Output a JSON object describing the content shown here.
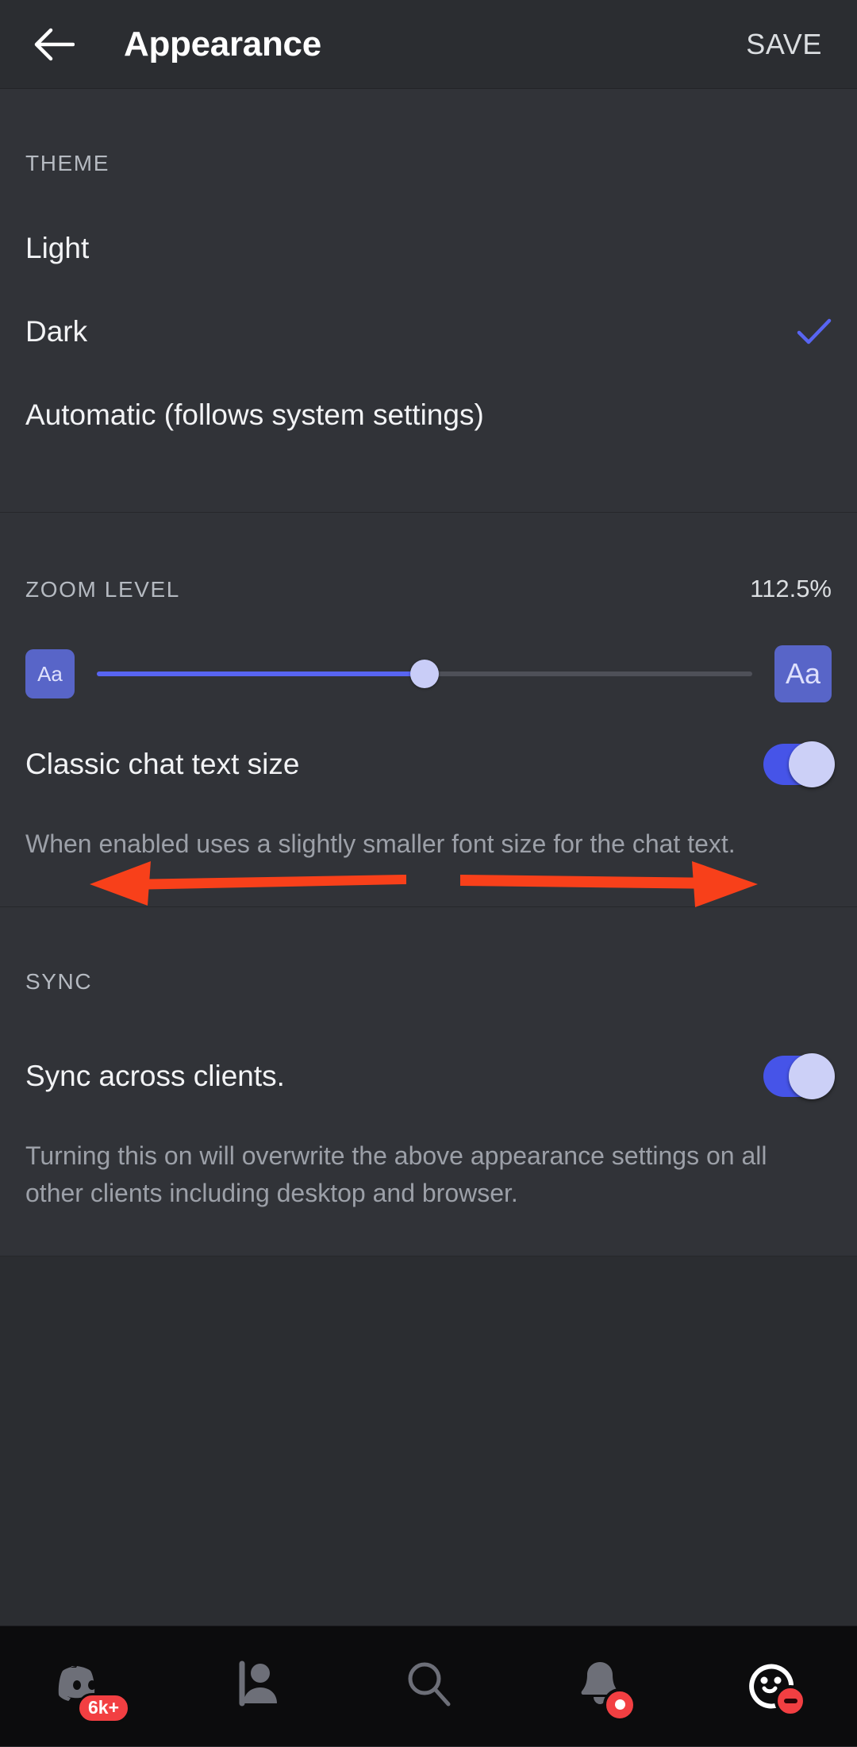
{
  "header": {
    "back_icon": "arrow-left-icon",
    "title": "Appearance",
    "save_label": "SAVE"
  },
  "theme": {
    "section_label": "THEME",
    "options": [
      {
        "label": "Light",
        "selected": false
      },
      {
        "label": "Dark",
        "selected": true
      },
      {
        "label": "Automatic (follows system settings)",
        "selected": false
      }
    ],
    "check_icon": "check-icon",
    "check_color": "#5865f2"
  },
  "zoom": {
    "section_label": "ZOOM LEVEL",
    "value": "112.5%",
    "slider": {
      "min_label": "Aa",
      "max_label": "Aa",
      "percent": 50,
      "fill_color": "#5865f2",
      "track_color": "#4e5058",
      "knob_color": "#c9cdf7"
    },
    "classic_text": {
      "label": "Classic chat text size",
      "enabled": true,
      "description": "When enabled uses a slightly smaller font size for the chat text."
    }
  },
  "annotation": {
    "color": "#f8401a",
    "left_arrow": "arrow-left-annotation",
    "right_arrow": "arrow-right-annotation"
  },
  "sync": {
    "section_label": "SYNC",
    "label": "Sync across clients.",
    "enabled": true,
    "description": "Turning this on will overwrite the above appearance settings on all other clients including desktop and browser."
  },
  "bottom_nav": {
    "items": [
      {
        "icon": "discord-servers-icon",
        "badge": "6k+",
        "badge_type": "count"
      },
      {
        "icon": "friends-icon",
        "badge": "",
        "badge_type": "none"
      },
      {
        "icon": "search-icon",
        "badge": "",
        "badge_type": "none"
      },
      {
        "icon": "notifications-bell-icon",
        "badge": "",
        "badge_type": "dot"
      },
      {
        "icon": "user-avatar-icon",
        "badge": "",
        "badge_type": "dnd"
      }
    ],
    "badge_color": "#f23f42"
  }
}
